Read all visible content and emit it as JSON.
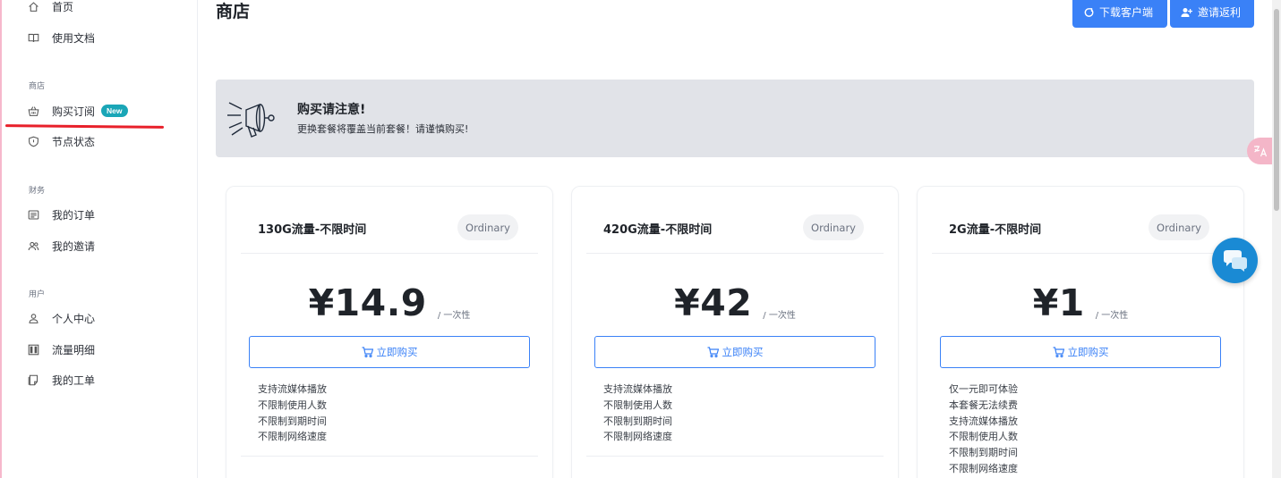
{
  "sidebar": {
    "items_top": [
      {
        "label": "首页",
        "icon": "home-icon"
      },
      {
        "label": "使用文档",
        "icon": "book-icon"
      }
    ],
    "sections": [
      {
        "label": "商店",
        "items": [
          {
            "label": "购买订阅",
            "icon": "shop-basket-icon",
            "badge": "New"
          },
          {
            "label": "节点状态",
            "icon": "shield-icon"
          }
        ]
      },
      {
        "label": "财务",
        "items": [
          {
            "label": "我的订单",
            "icon": "order-list-icon"
          },
          {
            "label": "我的邀请",
            "icon": "users-icon"
          }
        ]
      },
      {
        "label": "用户",
        "items": [
          {
            "label": "个人中心",
            "icon": "user-icon"
          },
          {
            "label": "流量明细",
            "icon": "traffic-chart-icon"
          },
          {
            "label": "我的工单",
            "icon": "ticket-icon"
          }
        ]
      }
    ]
  },
  "header": {
    "title": "商店",
    "download_label": "下载客户端",
    "invite_label": "邀请返利"
  },
  "notice": {
    "title": "购买请注意!",
    "text": "更换套餐将覆盖当前套餐！请谨慎购买!"
  },
  "plans": [
    {
      "name": "130G流量-不限时间",
      "tag": "Ordinary",
      "price": "¥14.9",
      "period": "/ 一次性",
      "buy_label": "立即购买",
      "features": [
        "支持流媒体播放",
        "不限制使用人数",
        "不限制到期时间",
        "不限制网络速度"
      ]
    },
    {
      "name": "420G流量-不限时间",
      "tag": "Ordinary",
      "price": "¥42",
      "period": "/ 一次性",
      "buy_label": "立即购买",
      "features": [
        "支持流媒体播放",
        "不限制使用人数",
        "不限制到期时间",
        "不限制网络速度"
      ]
    },
    {
      "name": "2G流量-不限时间",
      "tag": "Ordinary",
      "price": "¥1",
      "period": "/ 一次性",
      "buy_label": "立即购买",
      "features": [
        "仅一元即可体验",
        "本套餐无法续费",
        "支持流媒体播放",
        "不限制使用人数",
        "不限制到期时间",
        "不限制网络速度"
      ]
    }
  ],
  "colors": {
    "primary": "#3a81f7",
    "badge": "#1aa6b7",
    "highlight_underline": "#e8202a",
    "chat": "#1a8ad4"
  }
}
